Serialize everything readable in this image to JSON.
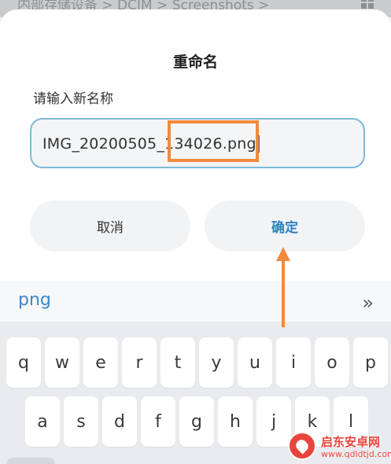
{
  "breadcrumb": {
    "path": "内部存储设备 > DCIM > Screenshots >"
  },
  "dialog": {
    "title": "重命名",
    "label": "请输入新名称",
    "input_value": "IMG_20200505_134026.png",
    "cancel_label": "取消",
    "confirm_label": "确定"
  },
  "suggestion": {
    "word": "png",
    "expand_icon": "double-chevron-right-icon"
  },
  "keyboard": {
    "row1": [
      "q",
      "w",
      "e",
      "r",
      "t",
      "y",
      "u",
      "i",
      "o",
      "p"
    ],
    "row2": [
      "a",
      "s",
      "d",
      "f",
      "g",
      "h",
      "j",
      "k",
      "l"
    ]
  },
  "watermark": {
    "title": "启东安卓网",
    "url": "www.qdldtjd.com"
  },
  "colors": {
    "accent": "#2f7fc6",
    "annotation": "#f08a3d",
    "input_border": "#7fb9d9",
    "watermark": "#e8453c"
  }
}
